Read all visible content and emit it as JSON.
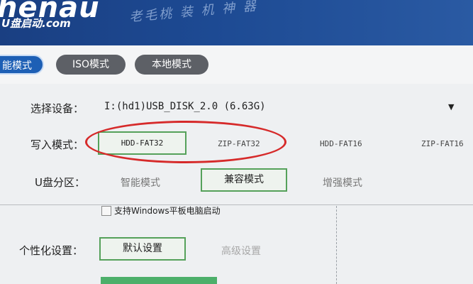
{
  "header": {
    "logo_text": "henau",
    "logo_sub": "U盘启动.com",
    "slogan": "老毛桃 装 机 神 器"
  },
  "tabs": [
    {
      "label": "能模式",
      "active": true
    },
    {
      "label": "ISO模式",
      "active": false
    },
    {
      "label": "本地模式",
      "active": false
    }
  ],
  "device": {
    "label": "选择设备：",
    "value": "I:(hd1)USB_DISK_2.0 (6.63G)"
  },
  "write_mode": {
    "label": "写入模式：",
    "options": [
      "HDD-FAT32",
      "ZIP-FAT32",
      "HDD-FAT16",
      "ZIP-FAT16"
    ],
    "selected": "HDD-FAT32"
  },
  "partition": {
    "label": "U盘分区：",
    "options": [
      "智能模式",
      "兼容模式",
      "增强模式"
    ],
    "selected": "兼容模式"
  },
  "tablet_boot": {
    "label": "支持Windows平板电脑启动",
    "checked": false
  },
  "personalize": {
    "label": "个性化设置：",
    "default_button": "默认设置",
    "advanced_button": "高级设置"
  },
  "colors": {
    "accent": "#1d5fb5",
    "selected_border": "#55a15a",
    "annotation": "#d62a2a"
  }
}
